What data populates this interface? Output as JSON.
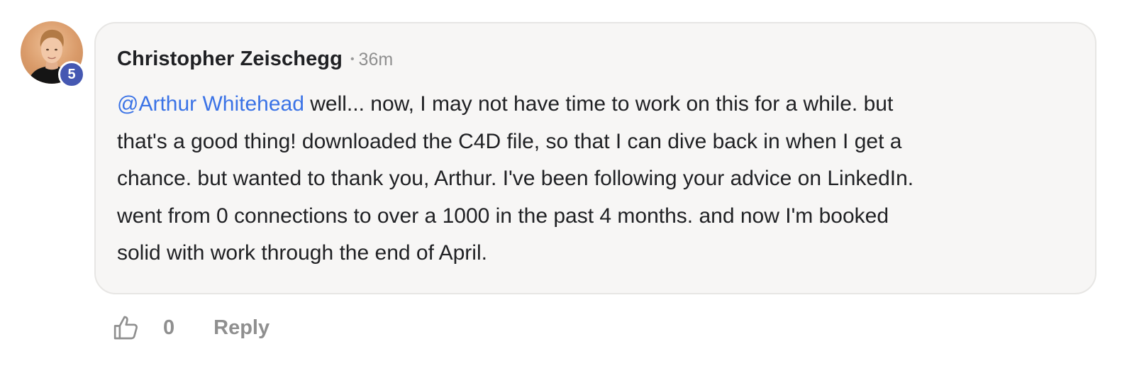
{
  "comment": {
    "author": {
      "name": "Christopher Zeischegg",
      "level": "5"
    },
    "separator": "•",
    "timestamp": "36m",
    "mention": "@Arthur Whitehead",
    "body_lines": [
      " well... now, I may not have time to work on this for a while. but",
      "that's a good thing! downloaded the C4D file, so that I can dive back in when I get a",
      "chance. but wanted to thank you, Arthur. I've been following your advice on LinkedIn.",
      "went from 0 connections to over a 1000 in the past 4 months. and now I'm booked",
      "solid with work through the end of April."
    ],
    "likes": "0",
    "reply_label": "Reply"
  },
  "colors": {
    "mention": "#3b73e6",
    "level_badge": "#4558b2",
    "bubble_background": "#f7f6f5",
    "bubble_border": "#e7e6e4",
    "muted_text": "#8f8f8f"
  },
  "icons": {
    "like": "thumbs-up-outline-icon"
  }
}
